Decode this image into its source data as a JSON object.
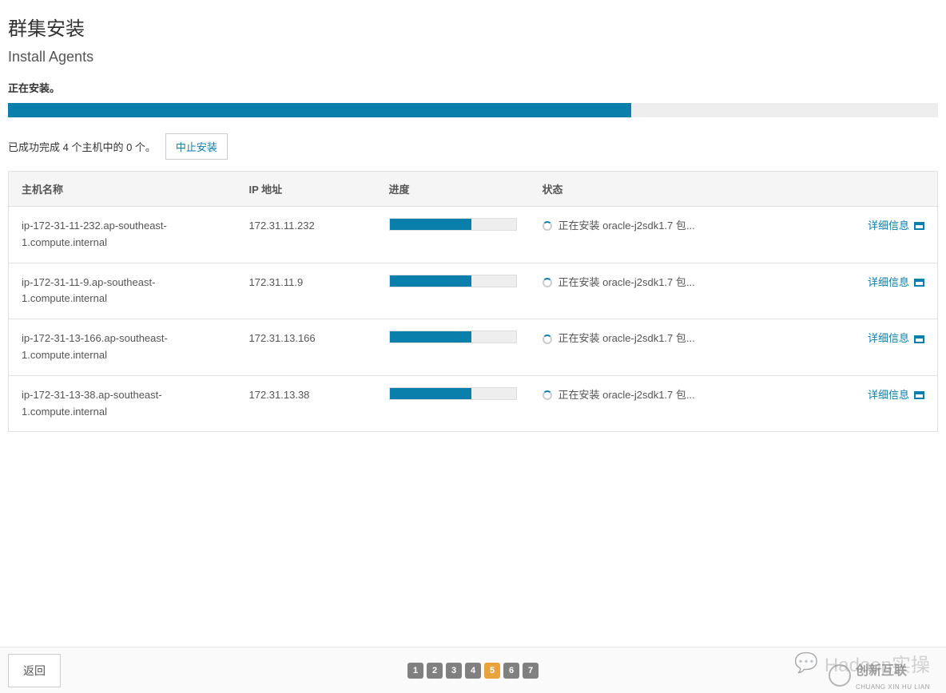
{
  "header": {
    "title": "群集安装",
    "subtitle": "Install Agents",
    "status": "正在安装。"
  },
  "overall_progress_percent": 67,
  "completion": {
    "text": "已成功完成 4 个主机中的 0 个。",
    "abort_label": "中止安装"
  },
  "table": {
    "columns": {
      "hostname": "主机名称",
      "ip": "IP 地址",
      "progress": "进度",
      "status": "状态"
    },
    "details_label": "详细信息",
    "rows": [
      {
        "hostname": "ip-172-31-11-232.ap-southeast-1.compute.internal",
        "ip": "172.31.11.232",
        "progress_percent": 65,
        "status": "正在安装 oracle-j2sdk1.7 包..."
      },
      {
        "hostname": "ip-172-31-11-9.ap-southeast-1.compute.internal",
        "ip": "172.31.11.9",
        "progress_percent": 65,
        "status": "正在安装 oracle-j2sdk1.7 包..."
      },
      {
        "hostname": "ip-172-31-13-166.ap-southeast-1.compute.internal",
        "ip": "172.31.13.166",
        "progress_percent": 65,
        "status": "正在安装 oracle-j2sdk1.7 包..."
      },
      {
        "hostname": "ip-172-31-13-38.ap-southeast-1.compute.internal",
        "ip": "172.31.13.38",
        "progress_percent": 65,
        "status": "正在安装 oracle-j2sdk1.7 包..."
      }
    ]
  },
  "footer": {
    "back_label": "返回",
    "pages": [
      "1",
      "2",
      "3",
      "4",
      "5",
      "6",
      "7"
    ],
    "active_page": "5"
  },
  "watermark": {
    "text1": "Hadoop实操",
    "text2": "创新互联",
    "subtext": "CHUANG XIN HU LIAN"
  }
}
